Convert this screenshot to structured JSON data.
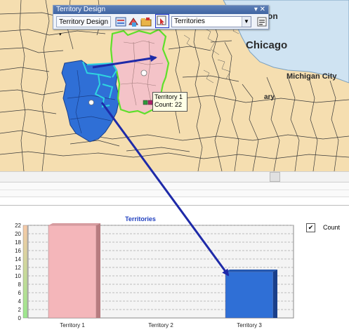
{
  "map": {
    "labels": {
      "city_chicago": "Chicago",
      "city_michigan": "Michigan City",
      "partial_on": "on",
      "partial_gary": "ary"
    },
    "colors": {
      "land": "#f5deb0",
      "lake": "#cfe3f2",
      "territory1_fill": "#f4c3c8",
      "territory1_border": "#5fe02b",
      "territory3_fill": "#2f6fd6",
      "selection": "#2fd4e0",
      "arrow": "#1e2aa8"
    }
  },
  "toolbar": {
    "title": "Territory Design",
    "dropdown_label": "Territory Design",
    "combo_value": "Territories",
    "window_controls": "▾ ✕",
    "icons": [
      "layer-icon",
      "add-territory-icon",
      "folder-icon",
      "select-territory-icon",
      "properties-icon"
    ]
  },
  "callout": {
    "name": "Territory 1",
    "count": "Count: 22"
  },
  "chart_data": {
    "type": "bar",
    "title": "Territories",
    "categories": [
      "Territory 1",
      "Territory 2",
      "Territory 3"
    ],
    "series": [
      {
        "name": "Count",
        "values": [
          22,
          0,
          11
        ]
      }
    ],
    "colors": [
      "#f4b6ba",
      "#ffffff",
      "#2f6fd6"
    ],
    "ylim": [
      0,
      22
    ],
    "yticks": [
      0,
      2,
      4,
      6,
      8,
      10,
      12,
      14,
      16,
      18,
      20,
      22
    ],
    "grid": true,
    "legend_position": "top-right"
  },
  "legend": {
    "checked_mark": "✔",
    "label": "Count"
  }
}
